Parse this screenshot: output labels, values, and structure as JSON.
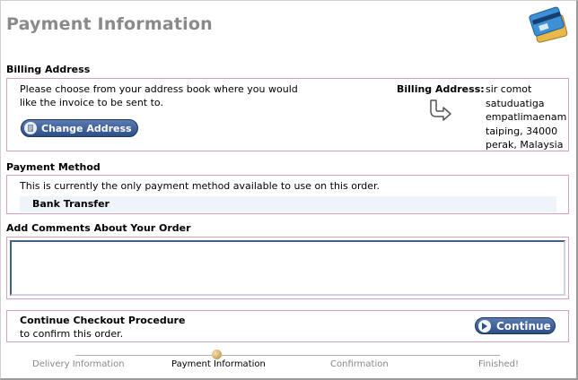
{
  "page_title": "Payment Information",
  "billing": {
    "section_title": "Billing Address",
    "instructions": "Please choose from your address book where you would like the invoice to be sent to.",
    "change_button": "Change Address",
    "address_label": "Billing Address:",
    "address_lines": [
      "sir comot",
      "satuduatiga",
      "empatlimaenam",
      "taiping, 34000",
      "perak, Malaysia"
    ]
  },
  "payment": {
    "section_title": "Payment Method",
    "note": "This is currently the only payment method available to use on this order.",
    "option": "Bank Transfer"
  },
  "comments": {
    "section_title": "Add Comments About Your Order",
    "value": ""
  },
  "continue": {
    "title": "Continue Checkout Procedure",
    "subtitle": "to confirm this order.",
    "button": "Continue"
  },
  "progress": {
    "steps": [
      "Delivery Information",
      "Payment Information",
      "Confirmation",
      "Finished!"
    ],
    "current_index": 1
  },
  "colors": {
    "title_gray": "#8a8a8a",
    "box_border": "#d6a0c0",
    "button_blue": "#2d4f87",
    "option_bg": "#eef4f9"
  },
  "icons": {
    "header": "credit-card-icon",
    "change_button": "address-book-icon",
    "billing_arrow": "curved-arrow-icon",
    "continue_button": "arrow-right-icon",
    "progress_marker": "progress-dot-icon"
  }
}
